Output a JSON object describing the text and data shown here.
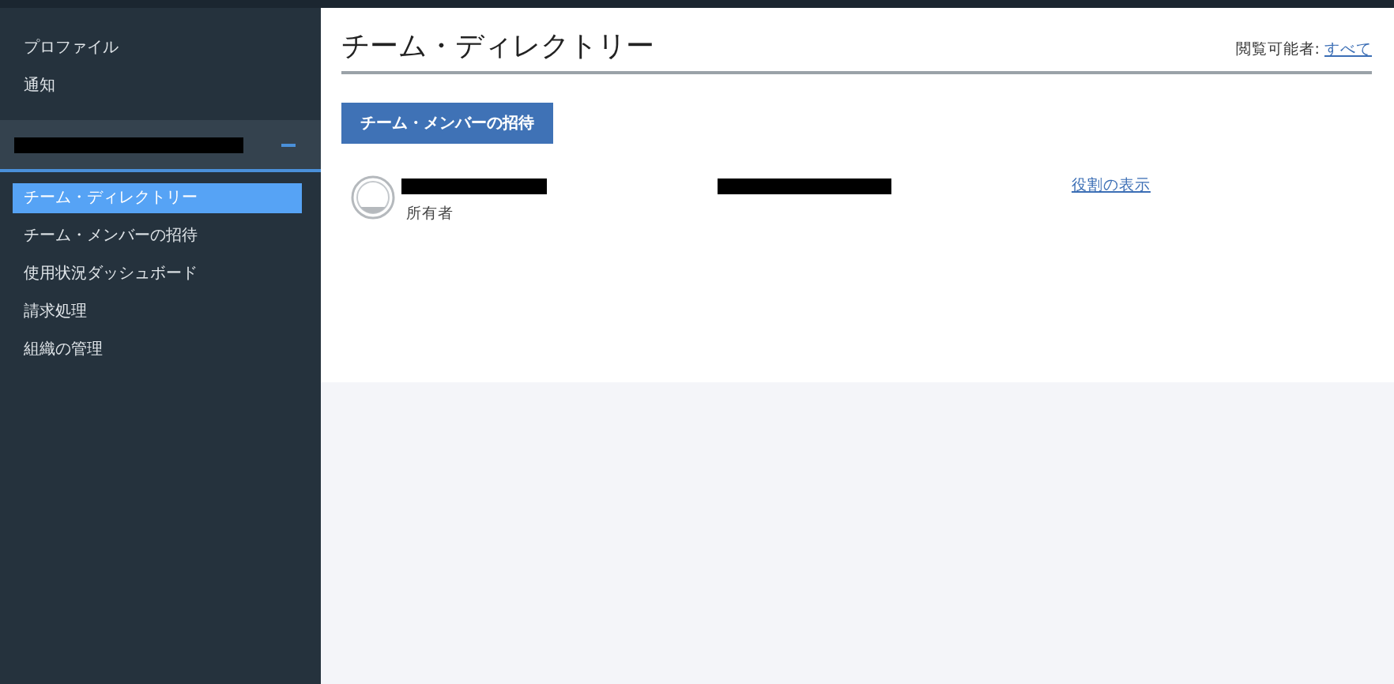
{
  "sidebar": {
    "top_items": [
      {
        "label": "プロファイル"
      },
      {
        "label": "通知"
      }
    ],
    "section": {
      "expanded": true
    },
    "items": [
      {
        "label": "チーム・ディレクトリー",
        "selected": true
      },
      {
        "label": "チーム・メンバーの招待",
        "selected": false
      },
      {
        "label": "使用状況ダッシュボード",
        "selected": false
      },
      {
        "label": "請求処理",
        "selected": false
      },
      {
        "label": "組織の管理",
        "selected": false
      }
    ]
  },
  "main": {
    "title": "チーム・ディレクトリー",
    "visibility_label": "閲覧可能者:",
    "visibility_link": "すべて",
    "invite_button": "チーム・メンバーの招待",
    "members": [
      {
        "role": "所有者",
        "action": "役割の表示"
      }
    ]
  }
}
